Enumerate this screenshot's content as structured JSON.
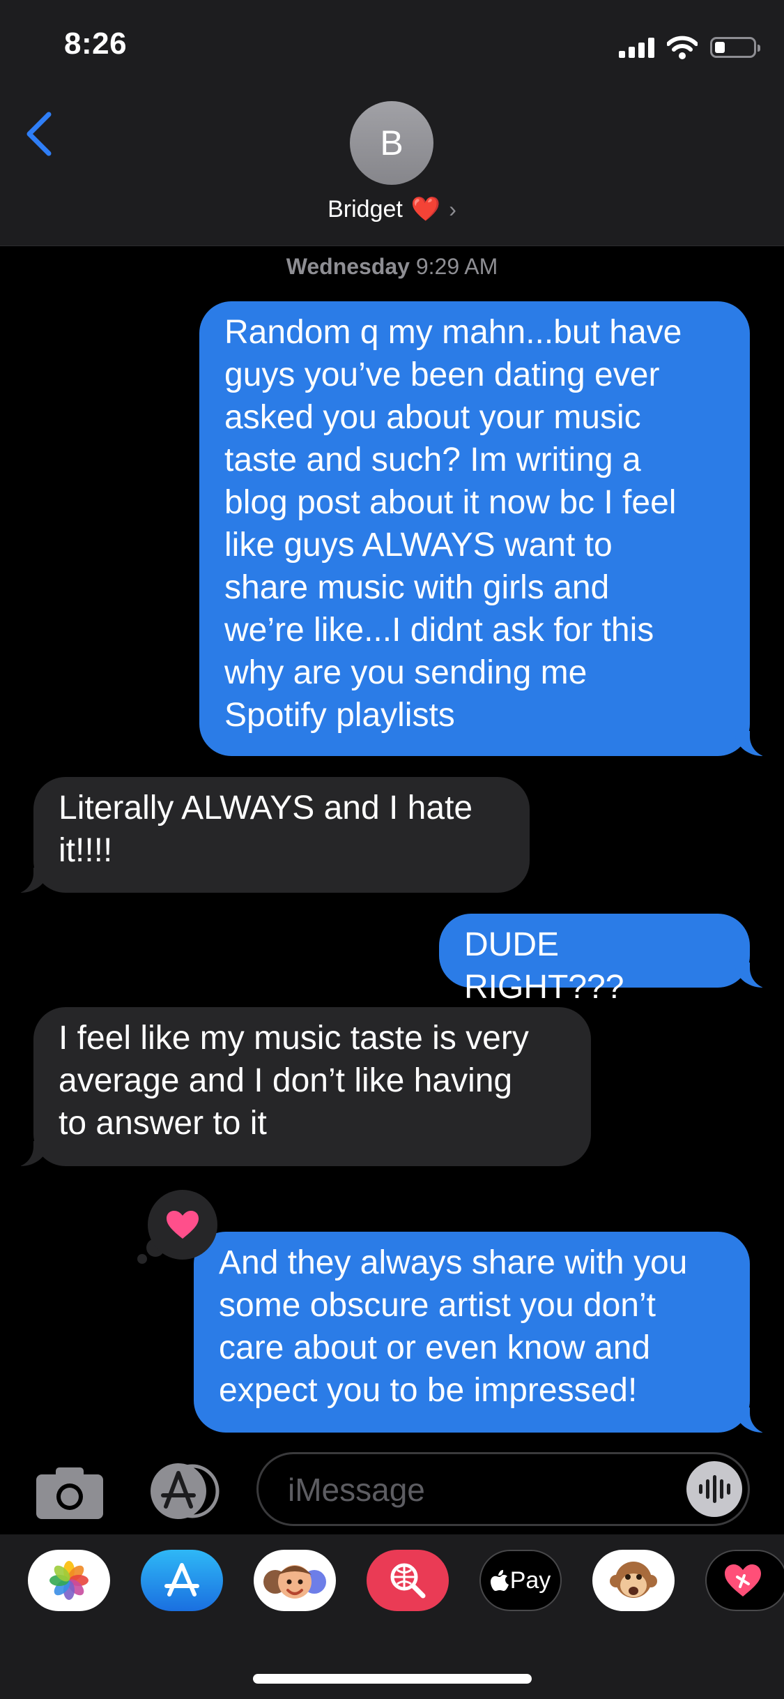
{
  "status_bar": {
    "time": "8:26"
  },
  "header": {
    "avatar_initial": "B",
    "contact_name": "Bridget",
    "contact_emoji": "❤️"
  },
  "thread": {
    "timestamp_day": "Wednesday",
    "timestamp_time": "9:29 AM",
    "messages": [
      {
        "sender": "me",
        "lines": [
          "Random q my mahn...but have",
          "guys you’ve been dating ever",
          "asked you about your music",
          "taste and such? Im writing a",
          "blog post about it now bc I feel",
          "like guys ALWAYS want to",
          "share music with girls and",
          "we’re like...I didnt ask for this",
          "why are you sending me",
          "Spotify playlists"
        ]
      },
      {
        "sender": "them",
        "lines": [
          "Literally ALWAYS and I hate",
          "it!!!!"
        ]
      },
      {
        "sender": "me",
        "lines": [
          "DUDE RIGHT???"
        ]
      },
      {
        "sender": "them",
        "lines": [
          "I feel like my music taste is very",
          "average and I don’t like having",
          "to answer to it"
        ]
      },
      {
        "sender": "me",
        "lines": [
          "And they always share with you",
          "some obscure artist you don’t",
          "care about or even know and",
          "expect you to be impressed!"
        ],
        "tapback": "heart"
      }
    ]
  },
  "input": {
    "placeholder": "iMessage"
  },
  "app_drawer": {
    "apps": [
      {
        "name": "photos",
        "icon": "photos-icon"
      },
      {
        "name": "app-store",
        "icon": "app-store-icon"
      },
      {
        "name": "memoji",
        "icon": "memoji-icon"
      },
      {
        "name": "image-search",
        "icon": "globe-search-icon"
      },
      {
        "name": "apple-pay",
        "icon": "apple-pay-icon",
        "label": "Pay"
      },
      {
        "name": "animoji",
        "icon": "monkey-icon"
      },
      {
        "name": "digital-touch",
        "icon": "heart-touch-icon"
      }
    ]
  },
  "colors": {
    "outgoing": "#2b7ce7",
    "incoming": "#262628",
    "accent": "#2f7ef6",
    "heart": "#ff4f8b"
  }
}
